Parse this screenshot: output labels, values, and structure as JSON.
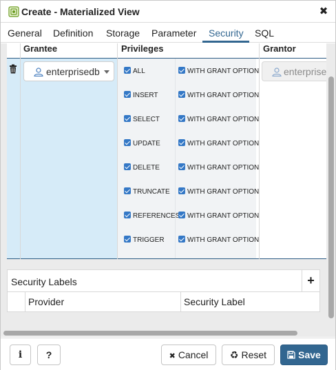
{
  "dialog": {
    "title": "Create - Materialized View",
    "close_glyph": "✖"
  },
  "tabs": [
    {
      "label": "General"
    },
    {
      "label": "Definition"
    },
    {
      "label": "Storage"
    },
    {
      "label": "Parameter"
    },
    {
      "label": "Security",
      "active": true
    },
    {
      "label": "SQL"
    }
  ],
  "privileges_grid": {
    "columns": {
      "grantee": "Grantee",
      "privileges": "Privileges",
      "grantor": "Grantor"
    },
    "row": {
      "grantee": "enterprisedb",
      "grantor": "enterprisedb",
      "privileges": [
        {
          "name": "ALL",
          "checked": true,
          "with_grant": "WITH GRANT OPTION",
          "with_grant_checked": true
        },
        {
          "name": "INSERT",
          "checked": true,
          "with_grant": "WITH GRANT OPTION",
          "with_grant_checked": true
        },
        {
          "name": "SELECT",
          "checked": true,
          "with_grant": "WITH GRANT OPTION",
          "with_grant_checked": true
        },
        {
          "name": "UPDATE",
          "checked": true,
          "with_grant": "WITH GRANT OPTION",
          "with_grant_checked": true
        },
        {
          "name": "DELETE",
          "checked": true,
          "with_grant": "WITH GRANT OPTION",
          "with_grant_checked": true
        },
        {
          "name": "TRUNCATE",
          "checked": true,
          "with_grant": "WITH GRANT OPTION",
          "with_grant_checked": true
        },
        {
          "name": "REFERENCES",
          "checked": true,
          "with_grant": "WITH GRANT OPTION",
          "with_grant_checked": true
        },
        {
          "name": "TRIGGER",
          "checked": true,
          "with_grant": "WITH GRANT OPTION",
          "with_grant_checked": true
        }
      ]
    }
  },
  "security_labels": {
    "title": "Security Labels",
    "add_glyph": "+",
    "columns": {
      "provider": "Provider",
      "label": "Security Label"
    }
  },
  "footer": {
    "info_glyph": "i",
    "help_glyph": "?",
    "cancel_icon": "✖",
    "cancel_label": "Cancel",
    "reset_icon": "♻",
    "reset_label": "Reset",
    "save_label": "Save"
  },
  "colors": {
    "accent": "#326690",
    "row_selected": "#d6ebf8",
    "checkbox": "#3478c6"
  }
}
